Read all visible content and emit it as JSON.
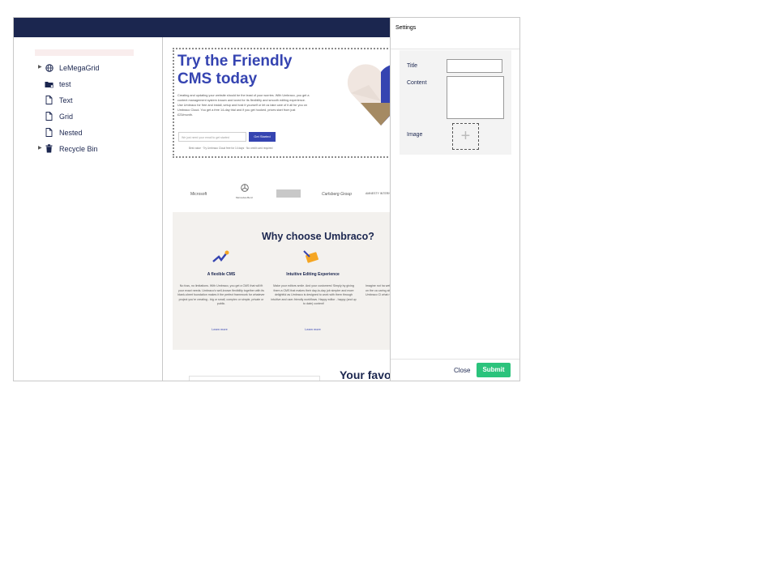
{
  "colors": {
    "topbar": "#1b264f",
    "accent": "#3544b1",
    "submit": "#2bc37c"
  },
  "tree": {
    "items": [
      {
        "label": "LeMegaGrid",
        "icon": "globe-icon",
        "expandable": true
      },
      {
        "label": "test",
        "icon": "folder-icon",
        "expandable": false
      },
      {
        "label": "Text",
        "icon": "document-icon",
        "expandable": false
      },
      {
        "label": "Grid",
        "icon": "document-icon",
        "expandable": false
      },
      {
        "label": "Nested",
        "icon": "document-icon",
        "expandable": false
      },
      {
        "label": "Recycle Bin",
        "icon": "trash-icon",
        "expandable": true
      }
    ]
  },
  "preview": {
    "hero": {
      "title": "Try the Friendly CMS today",
      "text": "Creating and updating your website should be the least of your worries. With Umbraco, you get a content management system known and loved for its flexibility and smooth editing experience. Use Umbraco for free and install, setup and host it yourself or let us take care of it all for you on Umbraco Cloud. You get a free 14-day trial and if you get hooked, prices start from just £23/month.",
      "input_placeholder": "We just need your email to get started",
      "button": "Get Started",
      "note": "Best value · Try Umbraco Cloud free for 14 days · No credit card required"
    },
    "logos": [
      "Microsoft",
      "Mercedes-Benz",
      "",
      "Carlsberg Group",
      "AMNESTY INTERNATIONAL"
    ],
    "why": {
      "title": "Why choose Umbraco?",
      "features": [
        {
          "title": "A flexible CMS",
          "text": "No fuss, no limitations. With Umbraco, you get a CMS that will fit your exact needs. Umbraco's well-known flexibility together with its blank-sheet foundation makes it the perfect framework for whatever project you're creating - big or small, complex or simple, private or public.",
          "link": "Learn more"
        },
        {
          "title": "Intuitive Editing Experience",
          "text": "Make your editors smile. And your customers! Simply by giving them a CMS that makes their day-to-day job simpler and more delightful as Umbraco is designed to work with them through intuitive and user-friendly workflows. Happy editor - happy (and up to date) content!",
          "link": "Learn more"
        },
        {
          "title": "C",
          "text": "Imagine not ha websites to the time on the ca caring about ha you Umbraco Cl what really m",
          "link": ""
        }
      ]
    },
    "fav_title": "Your favo"
  },
  "settings": {
    "title": "Settings",
    "fields": {
      "title_label": "Title",
      "content_label": "Content",
      "image_label": "Image"
    },
    "title_value": "",
    "content_value": "",
    "close": "Close",
    "submit": "Submit"
  }
}
